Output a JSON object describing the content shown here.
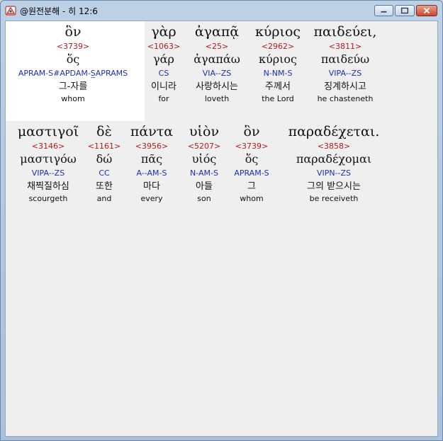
{
  "window": {
    "title": "@원전분해 - 히 12:6",
    "icon": "bible-app-icon"
  },
  "controls": {
    "minimize": "minimize-icon",
    "maximize": "maximize-icon",
    "close": "close-icon"
  },
  "lines": [
    [
      {
        "greek": "ὃν",
        "strongs": "<3739>",
        "lemma": "ὅς",
        "parse": "APRAM-S#APDAM-S̲APRAMS",
        "korean": "그-자를",
        "english": "whom"
      },
      {
        "greek": "γὰρ",
        "strongs": "<1063>",
        "lemma": "γάρ",
        "parse": "CS",
        "korean": "이니라",
        "english": "for"
      },
      {
        "greek": "ἀγαπᾷ",
        "strongs": "<25>",
        "lemma": "ἀγαπάω",
        "parse": "VIA--ZS",
        "korean": "사랑하시는",
        "english": "loveth"
      },
      {
        "greek": "κύριος",
        "strongs": "<2962>",
        "lemma": "κύριος",
        "parse": "N-NM-S",
        "korean": "주께서",
        "english": "the Lord"
      },
      {
        "greek": "παιδεύει,",
        "strongs": "<3811>",
        "lemma": "παιδεύω",
        "parse": "VIPA--ZS",
        "korean": "징계하시고",
        "english": "he chasteneth"
      }
    ],
    [
      {
        "greek": "μαστιγοῖ",
        "strongs": "<3146>",
        "lemma": "μαστιγόω",
        "parse": "VIPA--ZS",
        "korean": "채찍질하심",
        "english": "scourgeth"
      },
      {
        "greek": "δὲ",
        "strongs": "<1161>",
        "lemma": "δώ",
        "parse": "CC",
        "korean": "또한",
        "english": "and"
      },
      {
        "greek": "πάντα",
        "strongs": "<3956>",
        "lemma": "πᾶς",
        "parse": "A--AM-S",
        "korean": "마다",
        "english": "every"
      },
      {
        "greek": "υἱὸν",
        "strongs": "<5207>",
        "lemma": "υἱός",
        "parse": "N-AM-S",
        "korean": "아들",
        "english": "son"
      },
      {
        "greek": "ὃν",
        "strongs": "<3739>",
        "lemma": "ὅς",
        "parse": "APRAM-S",
        "korean": "그",
        "english": "whom"
      },
      {
        "greek": "παραδέχεται.",
        "strongs": "<3858>",
        "lemma": "παραδέχομαι",
        "parse": "VIPN--ZS",
        "korean": "그의 받으시는",
        "english": "be receiveth"
      }
    ]
  ]
}
